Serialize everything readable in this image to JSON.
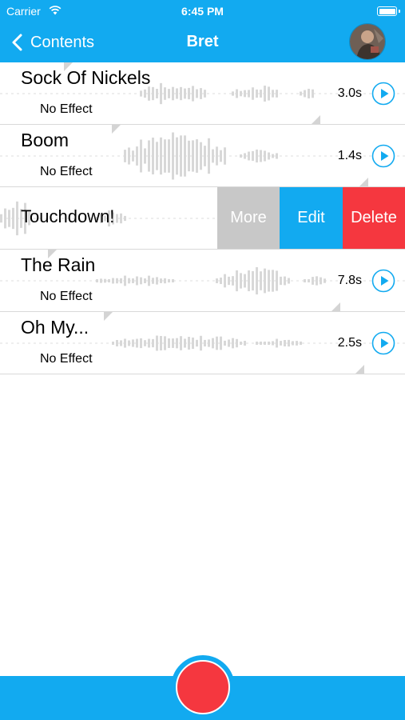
{
  "status_bar": {
    "carrier": "Carrier",
    "time": "6:45 PM"
  },
  "nav": {
    "back_label": "Contents",
    "title": "Bret"
  },
  "recordings": [
    {
      "name": "Sock Of Nickels",
      "effect": "No Effect",
      "duration": "3.0s"
    },
    {
      "name": "Boom",
      "effect": "No Effect",
      "duration": "1.4s"
    },
    {
      "name": "Touchdown!",
      "effect": "",
      "duration": ""
    },
    {
      "name": "The Rain",
      "effect": "No Effect",
      "duration": "7.8s"
    },
    {
      "name": "Oh My...",
      "effect": "No Effect",
      "duration": "2.5s"
    }
  ],
  "swipe_actions": {
    "more": "More",
    "edit": "Edit",
    "delete": "Delete"
  },
  "colors": {
    "accent": "#12aaf0",
    "record": "#f5373f",
    "more": "#c8c8c8",
    "delete": "#f5373f"
  }
}
